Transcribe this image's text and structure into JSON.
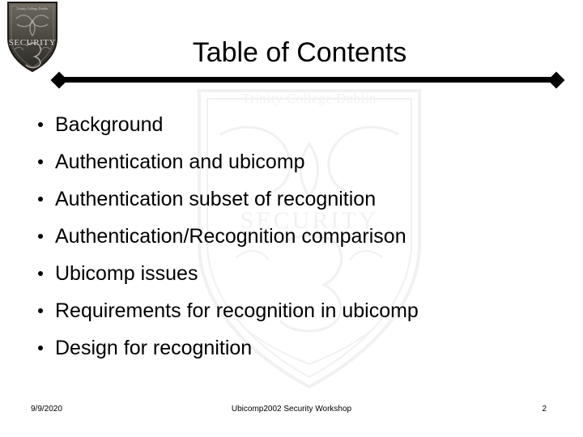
{
  "slide": {
    "title": "Table of Contents",
    "background_color": "#ffffff",
    "text_color": "#000000"
  },
  "logo": {
    "name": "tcd-security-crest",
    "band_text": "SECURITY",
    "top_text": "Trinity College Dublin"
  },
  "watermark": {
    "top_text": "Trinity College Dublin",
    "middle_text": "SECURITY",
    "color": "#6b665c"
  },
  "divider": {
    "color": "#000000",
    "cap_shape": "diamond"
  },
  "bullets": [
    {
      "text": "Background"
    },
    {
      "text": "Authentication and ubicomp"
    },
    {
      "text": "Authentication subset of recognition"
    },
    {
      "text": "Authentication/Recognition comparison"
    },
    {
      "text": "Ubicomp issues"
    },
    {
      "text": "Requirements for recognition in ubicomp"
    },
    {
      "text": "Design for recognition"
    }
  ],
  "footer": {
    "date": "9/9/2020",
    "center": "Ubicomp2002 Security Workshop",
    "page_number": "2"
  }
}
